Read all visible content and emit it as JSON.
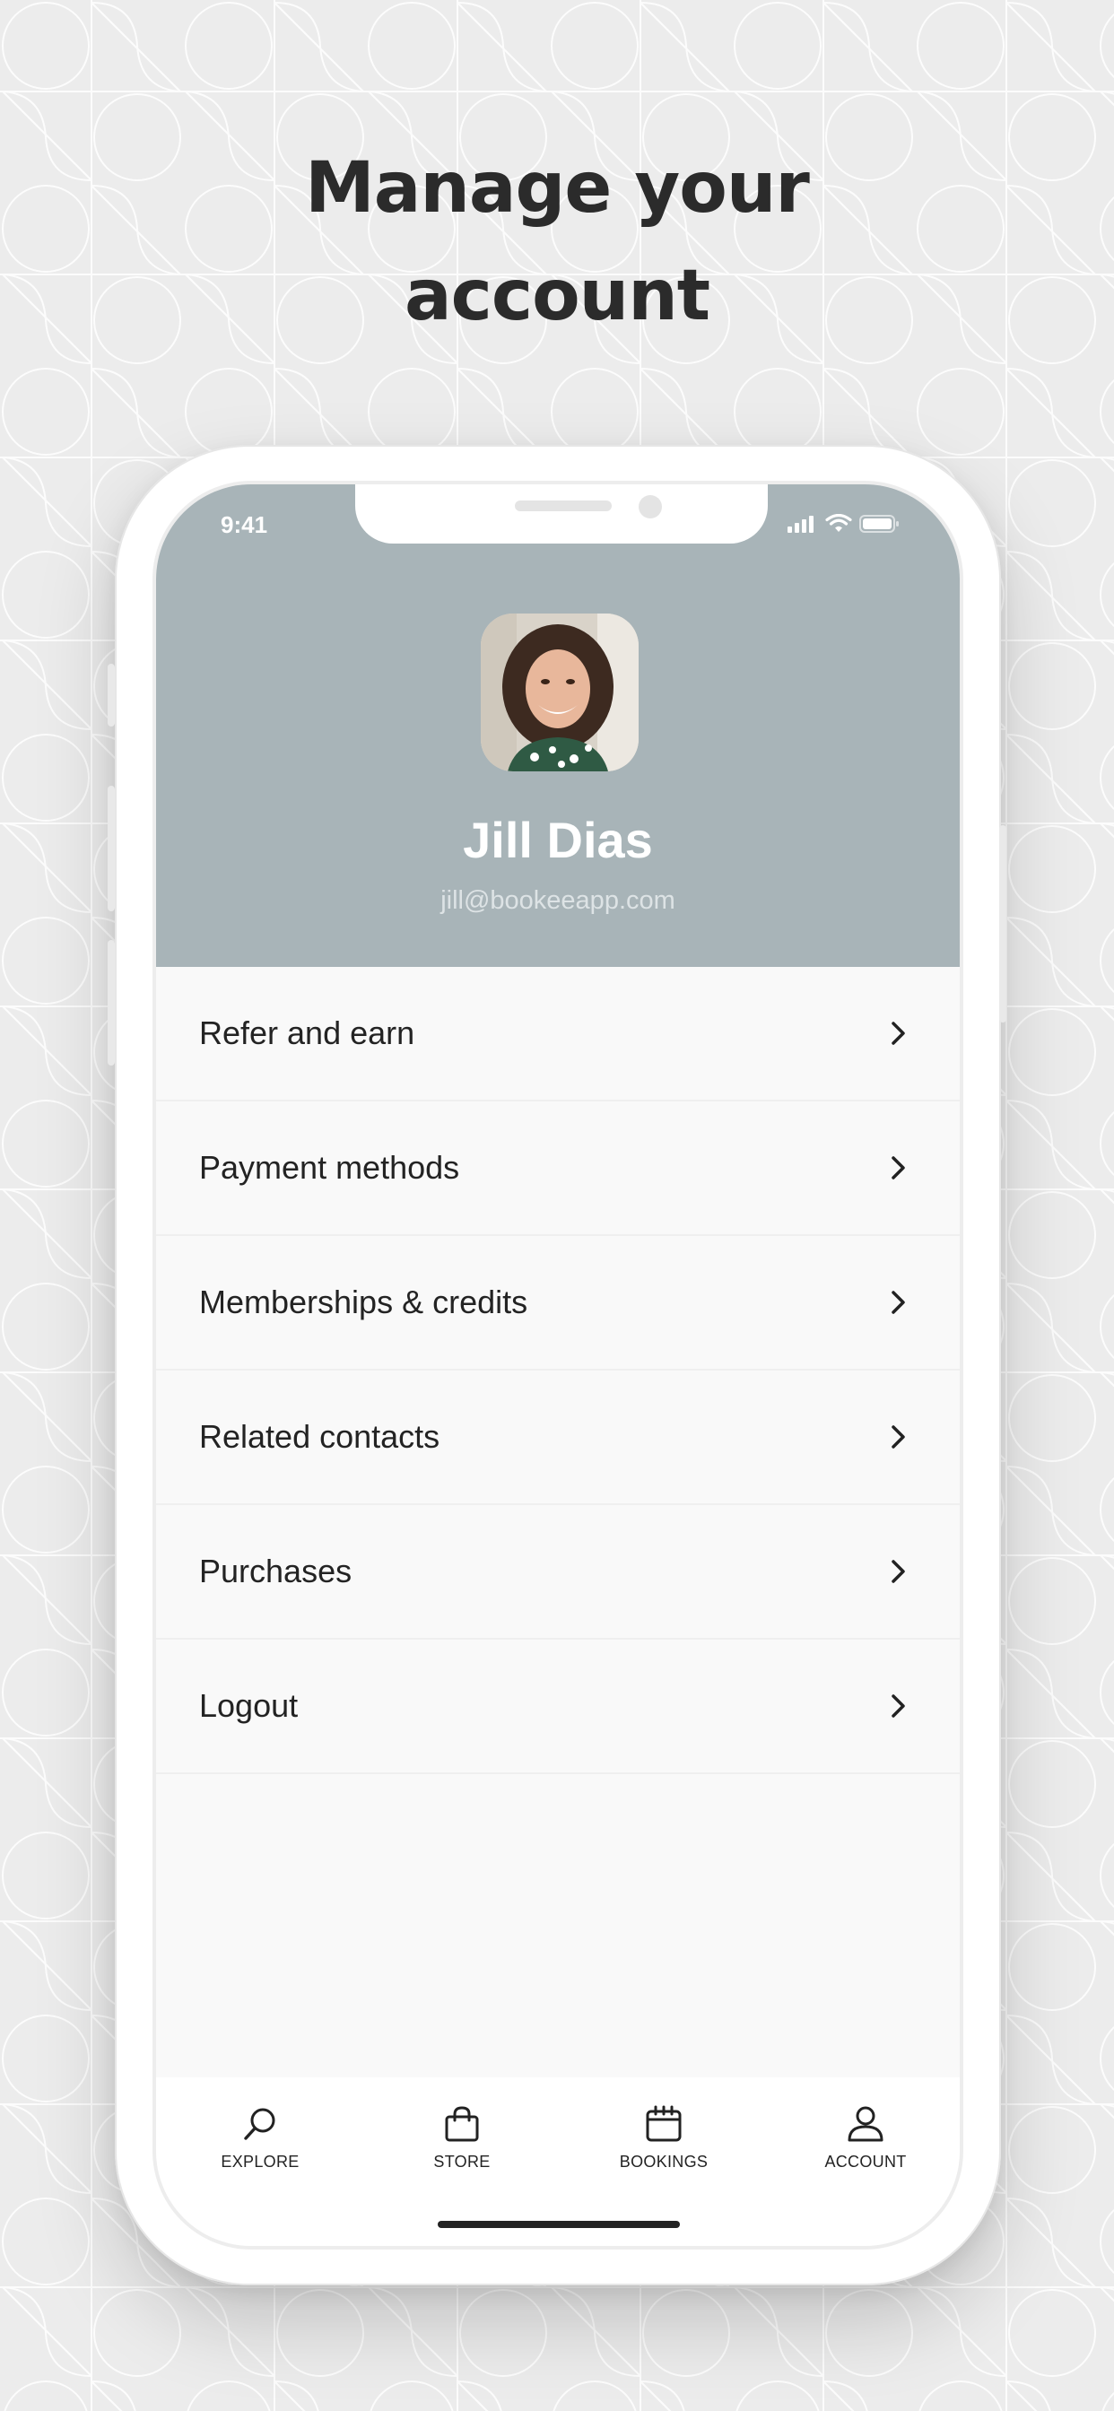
{
  "headline": {
    "line1": "Manage your",
    "line2": "account"
  },
  "status_bar": {
    "time": "9:41",
    "icons": [
      "signal-icon",
      "wifi-icon",
      "battery-icon"
    ]
  },
  "profile": {
    "name": "Jill Dias",
    "email": "jill@bookeeapp.com",
    "avatar_icon": "avatar-photo"
  },
  "menu": {
    "items": [
      {
        "label": "Refer and earn"
      },
      {
        "label": "Payment methods"
      },
      {
        "label": "Memberships & credits"
      },
      {
        "label": "Related contacts"
      },
      {
        "label": "Purchases"
      },
      {
        "label": "Logout"
      }
    ]
  },
  "tabbar": {
    "tabs": [
      {
        "label": "EXPLORE",
        "icon": "search-icon"
      },
      {
        "label": "STORE",
        "icon": "shopping-bag-icon"
      },
      {
        "label": "BOOKINGS",
        "icon": "calendar-icon"
      },
      {
        "label": "ACCOUNT",
        "icon": "user-icon",
        "active": true
      }
    ]
  },
  "colors": {
    "background": "#ececec",
    "header": "#a8b4b8",
    "text": "#232323",
    "headline": "#2b2b2b"
  }
}
